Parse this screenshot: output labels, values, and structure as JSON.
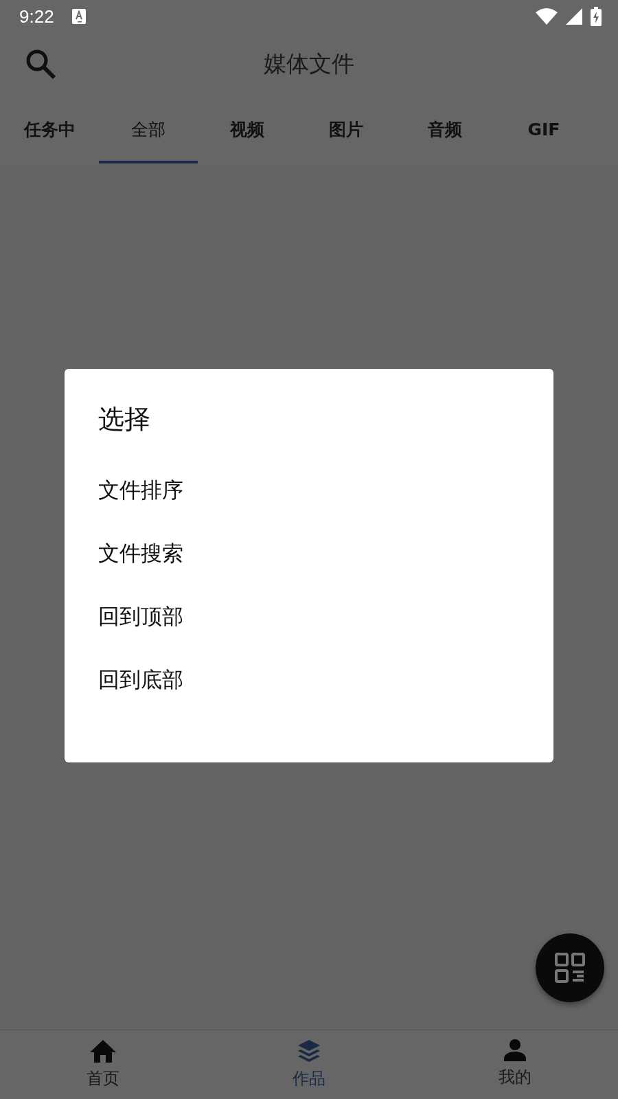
{
  "status_bar": {
    "time": "9:22"
  },
  "app_bar": {
    "title": "媒体文件"
  },
  "tabs": [
    {
      "label": "任务中",
      "selected": false
    },
    {
      "label": "全部",
      "selected": true
    },
    {
      "label": "视频",
      "selected": false
    },
    {
      "label": "图片",
      "selected": false
    },
    {
      "label": "音频",
      "selected": false
    },
    {
      "label": "GIF",
      "selected": false
    }
  ],
  "dialog": {
    "title": "选择",
    "options": [
      "文件排序",
      "文件搜索",
      "回到顶部",
      "回到底部"
    ]
  },
  "bottom_nav": [
    {
      "label": "首页",
      "kind": "home",
      "selected": false
    },
    {
      "label": "作品",
      "kind": "layers",
      "selected": true
    },
    {
      "label": "我的",
      "kind": "person",
      "selected": false
    }
  ]
}
